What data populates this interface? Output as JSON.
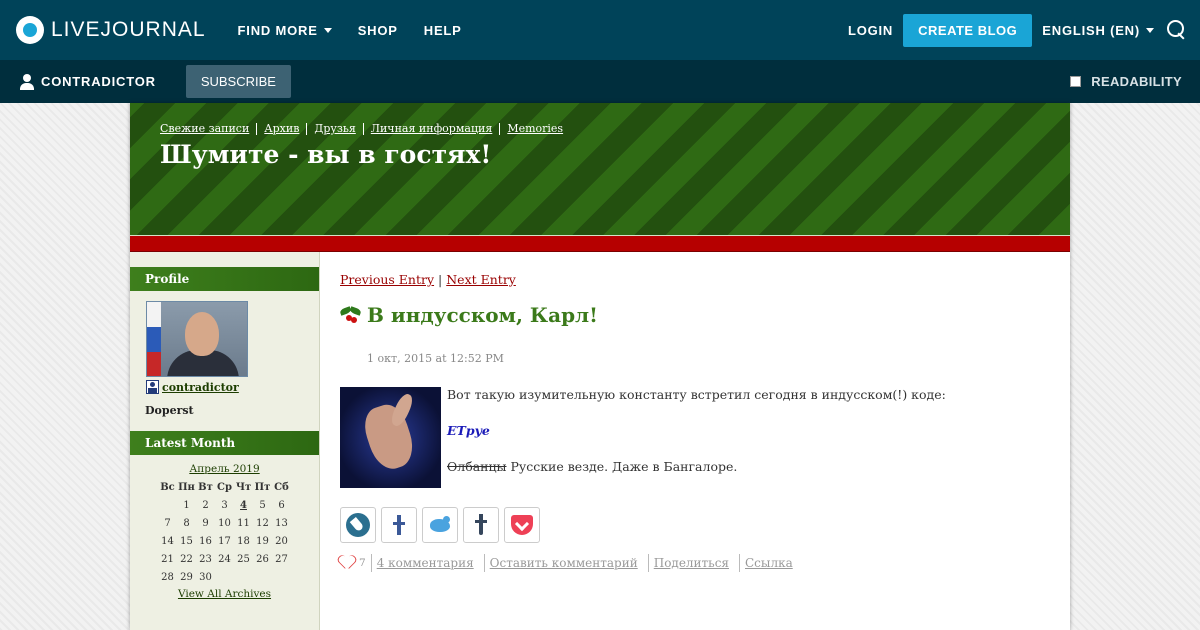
{
  "topbar": {
    "logo_text": "LIVEJOURNAL",
    "nav": [
      {
        "label": "FIND MORE",
        "dropdown": true
      },
      {
        "label": "SHOP"
      },
      {
        "label": "HELP"
      }
    ],
    "login_label": "LOGIN",
    "create_blog_label": "CREATE BLOG",
    "language_label": "ENGLISH (EN)"
  },
  "subbar": {
    "username": "CONTRADICTOR",
    "subscribe_label": "SUBSCRIBE",
    "readability_label": "READABILITY"
  },
  "header": {
    "nav": [
      "Свежие записи",
      "Архив",
      "Друзья",
      "Личная информация",
      "Memories"
    ],
    "title": "Шумите - вы в гостях!"
  },
  "sidebar": {
    "profile_heading": "Profile",
    "user_link": "contradictor",
    "user_subtitle": "Doperst",
    "latest_month_heading": "Latest Month",
    "calendar": {
      "title": "Апрель 2019",
      "weekdays": [
        "Вс",
        "Пн",
        "Вт",
        "Ср",
        "Чт",
        "Пт",
        "Сб"
      ],
      "weeks": [
        [
          "",
          "1",
          "2",
          "3",
          "4",
          "5",
          "6"
        ],
        [
          "7",
          "8",
          "9",
          "10",
          "11",
          "12",
          "13"
        ],
        [
          "14",
          "15",
          "16",
          "17",
          "18",
          "19",
          "20"
        ],
        [
          "21",
          "22",
          "23",
          "24",
          "25",
          "26",
          "27"
        ],
        [
          "28",
          "29",
          "30",
          "",
          "",
          "",
          ""
        ]
      ],
      "linked_day": "4",
      "view_all_label": "View All Archives"
    }
  },
  "entry": {
    "previous_label": "Previous Entry",
    "separator": "|",
    "next_label": "Next Entry",
    "title": "В индусском, Карл!",
    "date": "1 окт, 2015 at 12:52 PM",
    "paragraph1": "Вот такую изумительную константу встретил сегодня в индусском(!) коде:",
    "code_word": "ETpye",
    "strike_text": "Олбанцы",
    "paragraph3_rest": " Русские везде. Даже в Бангалоре.",
    "like_count": "7",
    "actions": [
      "4 комментария",
      "Оставить комментарий",
      "Поделиться",
      "Ссылка"
    ]
  },
  "colors": {
    "topbar": "#004359",
    "subbar": "#002e3d",
    "create_blog": "#1aa5d6",
    "header_green": "#2f6a14",
    "header_red": "#b60000",
    "title_green": "#3b7a1a",
    "link_red": "#990000"
  }
}
